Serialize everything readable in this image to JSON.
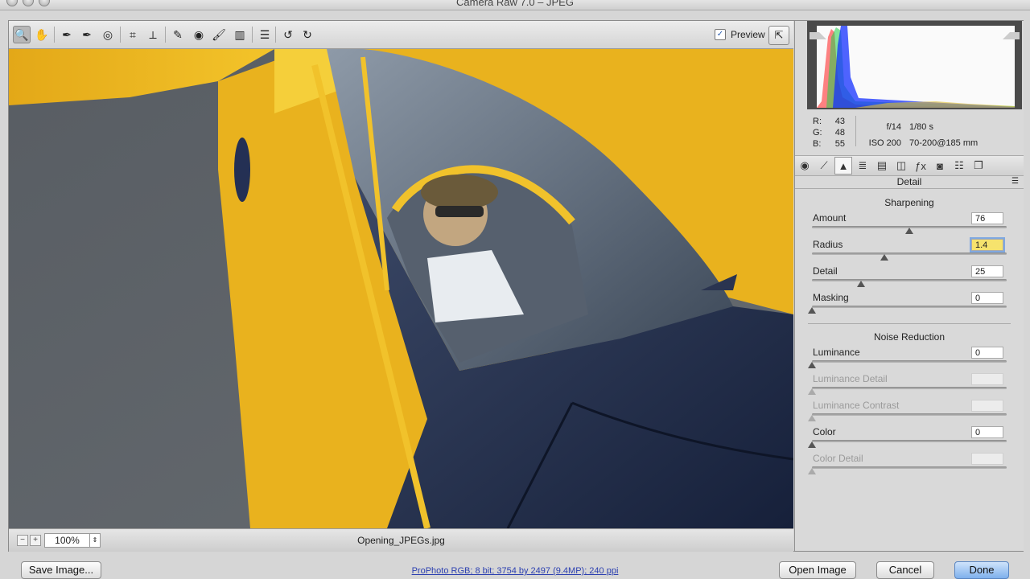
{
  "window": {
    "title": "Camera Raw 7.0  –  JPEG"
  },
  "toolbar": {
    "tools": [
      {
        "icon": "zoom-icon",
        "glyph": "🔍",
        "active": true
      },
      {
        "icon": "hand-icon",
        "glyph": "✋"
      },
      {
        "icon": "white-balance-icon",
        "glyph": "✒"
      },
      {
        "icon": "color-sampler-icon",
        "glyph": "✒"
      },
      {
        "icon": "targeted-adjustment-icon",
        "glyph": "◎"
      },
      {
        "icon": "crop-icon",
        "glyph": "⌗"
      },
      {
        "icon": "straighten-icon",
        "glyph": "⟂"
      },
      {
        "icon": "spot-removal-icon",
        "glyph": "✎"
      },
      {
        "icon": "red-eye-icon",
        "glyph": "◉"
      },
      {
        "icon": "adjustment-brush-icon",
        "glyph": "🖌"
      },
      {
        "icon": "graduated-filter-icon",
        "glyph": "▥"
      },
      {
        "icon": "preferences-icon",
        "glyph": "☰"
      },
      {
        "icon": "rotate-left-icon",
        "glyph": "↺"
      },
      {
        "icon": "rotate-right-icon",
        "glyph": "↻"
      }
    ],
    "preview_label": "Preview",
    "preview_checked": true
  },
  "image_bar": {
    "zoom": "100%",
    "filename": "Opening_JPEGs.jpg"
  },
  "info": {
    "r_label": "R:",
    "r": "43",
    "g_label": "G:",
    "g": "48",
    "b_label": "B:",
    "b": "55",
    "aperture": "f/14",
    "shutter": "1/80 s",
    "iso": "ISO 200",
    "lens": "70-200@185 mm"
  },
  "panel_tabs": [
    "basic-icon",
    "tone-curve-icon",
    "detail-icon",
    "hsl-icon",
    "split-toning-icon",
    "lens-corrections-icon",
    "effects-icon",
    "camera-calibration-icon",
    "presets-icon",
    "snapshots-icon"
  ],
  "panel": {
    "title": "Detail",
    "sharpening": {
      "title": "Sharpening",
      "sliders": [
        {
          "label": "Amount",
          "value": "76",
          "level": 0.5
        },
        {
          "label": "Radius",
          "value": "1.4",
          "level": 0.37,
          "focused": true
        },
        {
          "label": "Detail",
          "value": "25",
          "level": 0.25
        },
        {
          "label": "Masking",
          "value": "0",
          "level": 0
        }
      ]
    },
    "noise": {
      "title": "Noise Reduction",
      "sliders": [
        {
          "label": "Luminance",
          "value": "0",
          "level": 0
        },
        {
          "label": "Luminance Detail",
          "value": "",
          "level": 0,
          "disabled": true
        },
        {
          "label": "Luminance Contrast",
          "value": "",
          "level": 0,
          "disabled": true
        },
        {
          "label": "Color",
          "value": "0",
          "level": 0
        },
        {
          "label": "Color Detail",
          "value": "",
          "level": 0,
          "disabled": true
        }
      ]
    }
  },
  "bottom": {
    "save": "Save Image...",
    "workflow": "ProPhoto RGB; 8 bit; 3754 by 2497 (9.4MP); 240 ppi",
    "open": "Open Image",
    "cancel": "Cancel",
    "done": "Done"
  }
}
